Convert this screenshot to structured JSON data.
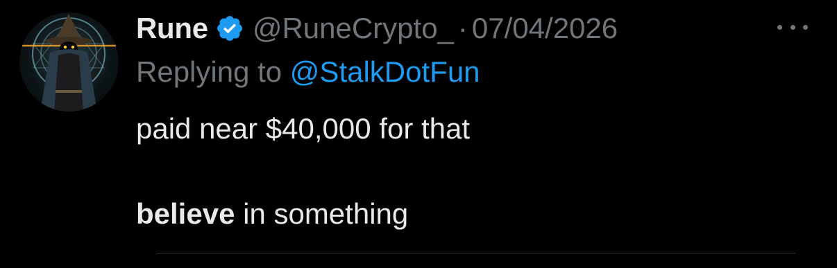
{
  "tweet": {
    "display_name": "Rune",
    "handle": "@RuneCrypto_",
    "separator": "·",
    "date": "07/04/2026",
    "replying_prefix": "Replying to",
    "replying_mention": "@StalkDotFun",
    "text_line1": "paid near $40,000 for that",
    "text_line2_bold": "believe",
    "text_line2_rest": " in something"
  },
  "icons": {
    "verified": "verified-badge-icon",
    "more": "more-options-icon",
    "avatar": "avatar"
  },
  "colors": {
    "background": "#000000",
    "primary_text": "#e7e9ea",
    "secondary_text": "#71767b",
    "link": "#1d9bf0",
    "verified": "#1d9bf0"
  }
}
